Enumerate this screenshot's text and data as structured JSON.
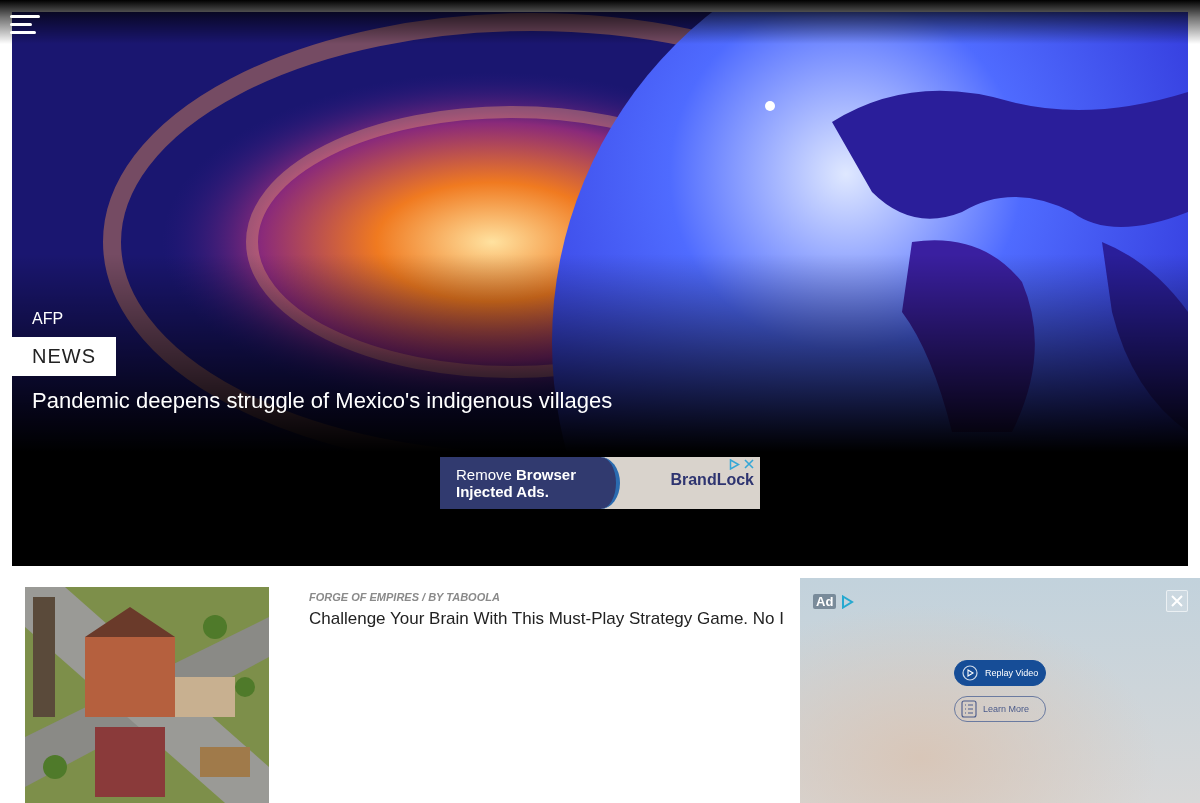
{
  "hero": {
    "kind": "picture",
    "source": "AFP",
    "category": "NEWS",
    "headline": "Pandemic deepens struggle of Mexico's indigenous villages"
  },
  "banner_ad": {
    "text": "Remove **Browser** **Injected Ads.**",
    "brand": "BrandLock"
  },
  "sponsored": {
    "kind": "picture",
    "source": "FORGE OF EMPIRES / BY TABOOLA",
    "headline": "Challenge Your Brain With This Must-Play Strategy Game. No I"
  },
  "video_ad": {
    "label": "Ad",
    "buttons": [
      "Replay Video",
      "Learn More"
    ]
  }
}
